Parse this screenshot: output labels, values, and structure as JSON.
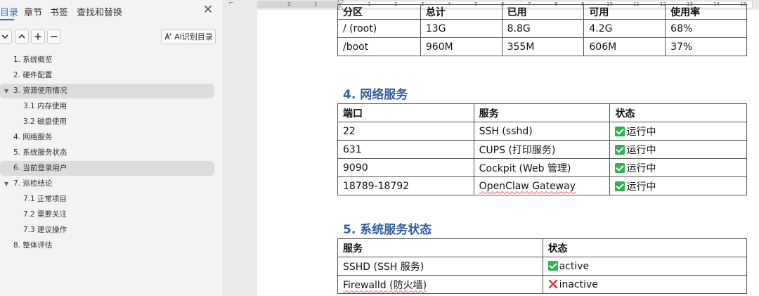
{
  "nav": {
    "tabs": [
      "目录",
      "章节",
      "书签",
      "查找和替换"
    ],
    "ai_button": "AI识别目录",
    "outline": [
      {
        "label": "1. 系统概览",
        "level": 1,
        "expanded": null,
        "highlighted": false
      },
      {
        "label": "2. 硬件配置",
        "level": 1,
        "expanded": null,
        "highlighted": false
      },
      {
        "label": "3. 资源使用情况",
        "level": 1,
        "expanded": true,
        "highlighted": true
      },
      {
        "label": "3.1 内存使用",
        "level": 2,
        "expanded": null,
        "highlighted": false
      },
      {
        "label": "3.2 磁盘使用",
        "level": 2,
        "expanded": null,
        "highlighted": false
      },
      {
        "label": "4. 网络服务",
        "level": 1,
        "expanded": null,
        "highlighted": false
      },
      {
        "label": "5. 系统服务状态",
        "level": 1,
        "expanded": null,
        "highlighted": false
      },
      {
        "label": "6. 当前登录用户",
        "level": 1,
        "expanded": null,
        "highlighted": true
      },
      {
        "label": "7. 巡检结论",
        "level": 1,
        "expanded": true,
        "highlighted": false
      },
      {
        "label": "7.1 正常项目",
        "level": 2,
        "expanded": null,
        "highlighted": false
      },
      {
        "label": "7.2 需要关注",
        "level": 2,
        "expanded": null,
        "highlighted": false
      },
      {
        "label": "7.3 建议操作",
        "level": 2,
        "expanded": null,
        "highlighted": false
      },
      {
        "label": "8. 整体评估",
        "level": 1,
        "expanded": null,
        "highlighted": false
      }
    ]
  },
  "ruler": {
    "numbers": [
      "2",
      "1",
      "1",
      "2",
      "3",
      "4",
      "5",
      "6",
      "7",
      "8",
      "9",
      "10",
      "11",
      "12",
      "13",
      "14",
      "15"
    ]
  },
  "doc": {
    "disk_table": {
      "headers": [
        "分区",
        "总计",
        "已用",
        "可用",
        "使用率"
      ],
      "rows": [
        [
          "/ (root)",
          "13G",
          "8.8G",
          "4.2G",
          "68%"
        ],
        [
          "/boot",
          "960M",
          "355M",
          "606M",
          "37%"
        ]
      ]
    },
    "section4": {
      "title": "4. 网络服务",
      "headers": [
        "端口",
        "服务",
        "状态"
      ],
      "rows": [
        {
          "port": "22",
          "service": "SSH (sshd)",
          "status": "运行中",
          "ok": true
        },
        {
          "port": "631",
          "service": "CUPS (打印服务)",
          "status": "运行中",
          "ok": true
        },
        {
          "port": "9090",
          "service": "Cockpit (Web 管理)",
          "status": "运行中",
          "ok": true
        },
        {
          "port": "18789-18792",
          "service": "OpenClaw Gateway",
          "status": "运行中",
          "ok": true
        }
      ]
    },
    "section5": {
      "title": "5. 系统服务状态",
      "headers": [
        "服务",
        "状态"
      ],
      "rows": [
        {
          "service": "SSHD (SSH 服务)",
          "status": "active",
          "ok": true
        },
        {
          "service": "Firewalld (防火墙)",
          "status": "inactive",
          "ok": false
        }
      ]
    }
  },
  "colors": {
    "accent": "#2b6fd6",
    "heading": "#2f5fa2",
    "ok": "#2eb351",
    "error": "#e0344a"
  }
}
